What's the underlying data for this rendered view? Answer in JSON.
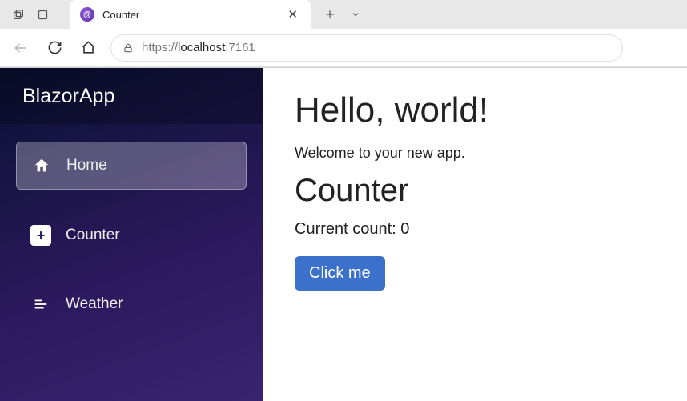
{
  "browser": {
    "tab_title": "Counter",
    "url_scheme": "https://",
    "url_host": "localhost",
    "url_port": ":7161"
  },
  "sidebar": {
    "brand": "BlazorApp",
    "items": [
      {
        "label": "Home",
        "icon": "house-icon",
        "active": true
      },
      {
        "label": "Counter",
        "icon": "plus-square-icon",
        "active": false
      },
      {
        "label": "Weather",
        "icon": "list-icon",
        "active": false
      }
    ]
  },
  "main": {
    "heading": "Hello, world!",
    "welcome": "Welcome to your new app.",
    "counter_heading": "Counter",
    "count_label": "Current count: ",
    "count_value": "0",
    "button_label": "Click me"
  }
}
